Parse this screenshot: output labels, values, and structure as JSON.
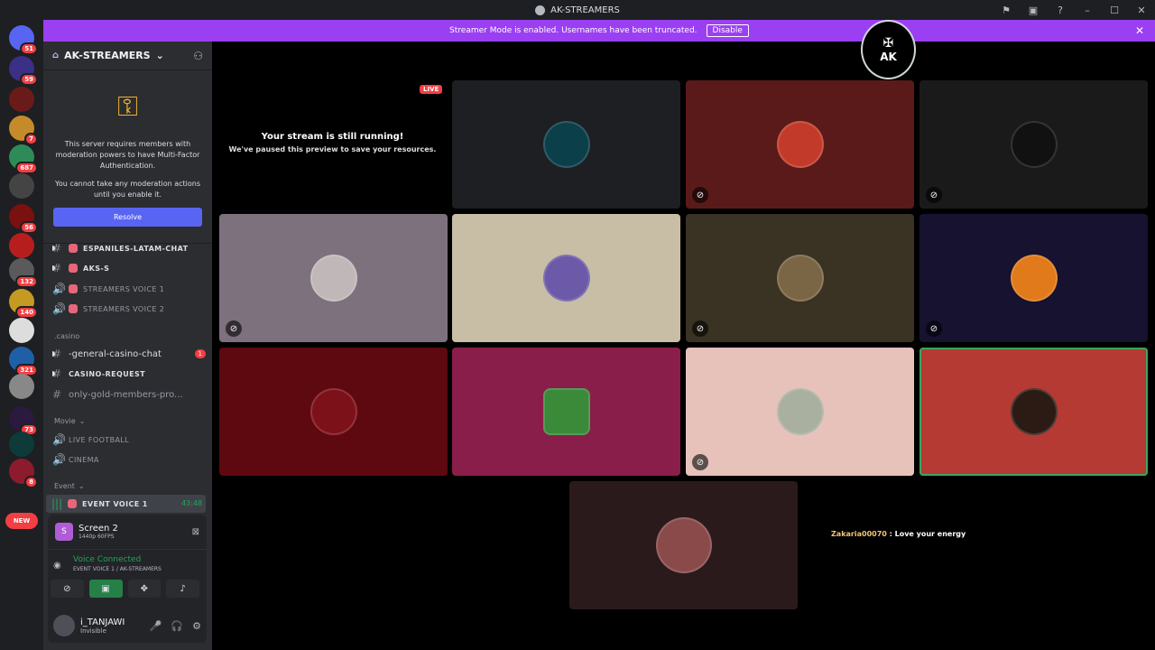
{
  "window": {
    "title": "AK-STREAMERS"
  },
  "banner": {
    "text": "Streamer Mode is enabled. Usernames have been truncated.",
    "disable_label": "Disable"
  },
  "server": {
    "name": "AK-STREAMERS"
  },
  "mfa": {
    "text1": "This server requires members with moderation powers to have Multi-Factor Authentication.",
    "text2": "You cannot take any moderation actions until you enable it.",
    "resolve_label": "Resolve"
  },
  "guild_badges": [
    "51",
    "59",
    "7",
    "687",
    "56",
    "132",
    "140",
    "321",
    "73",
    "8"
  ],
  "new_label": "NEW",
  "channels": {
    "espaniles": "ESPANILES-LATAM-CHAT",
    "aks": "AKS-S",
    "voice1": "STREAMERS VOICE 1",
    "voice2": "STREAMERS VOICE 2",
    "cat_casino": ".casino",
    "general_casino": "-general-casino-chat",
    "general_casino_count": "1",
    "casino_request": "CASINO-REQUEST",
    "gold": "only-gold-members-pro...",
    "cat_movie": "Movie",
    "live_football": "LIVE FOOTBALL",
    "cinema": "CINEMA",
    "cat_event": "Event",
    "event_voice": "EVENT VOICE 1",
    "event_time": "43:48"
  },
  "stream": {
    "title": "Screen 2",
    "quality": "1440p 60FPS"
  },
  "voice": {
    "status": "Voice Connected",
    "location": "EVENT VOICE 1 / AK-STREAMERS"
  },
  "user": {
    "name": "i_TANJAWI",
    "status": "Invisible"
  },
  "stage": {
    "live_label": "LIVE",
    "paused_title": "Your stream is still running!",
    "paused_sub": "We've paused this preview to save your resources.",
    "chat_user": "Zakaria00070",
    "chat_text": " : Love your energy"
  },
  "badge_text": "AK"
}
